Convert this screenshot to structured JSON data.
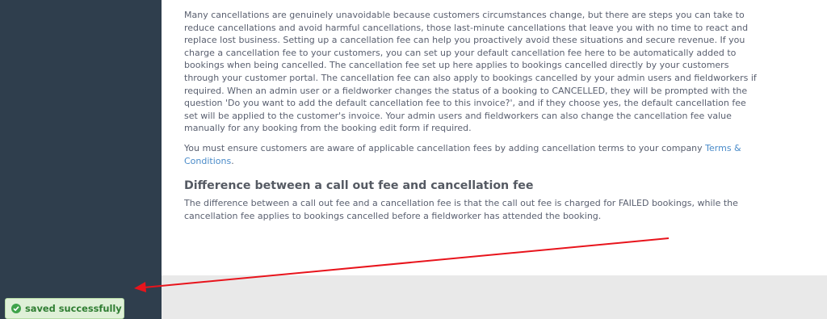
{
  "content": {
    "paragraph1": "Many cancellations are genuinely unavoidable because customers circumstances change, but there are steps you can take to reduce cancellations and avoid harmful cancellations, those last-minute cancellations that leave you with no time to react and replace lost business. Setting up a cancellation fee can help you proactively avoid these situations and secure revenue. If you charge a cancellation fee to your customers, you can set up your default cancellation fee here to be automatically added to bookings when being cancelled. The cancellation fee set up here applies to bookings cancelled directly by your customers through your customer portal. The cancellation fee can also apply to bookings cancelled by your admin users and fieldworkers if required. When an admin user or a fieldworker changes the status of a booking to CANCELLED, they will be prompted with the question 'Do you want to add the default cancellation fee to this invoice?', and if they choose yes, the default cancellation fee set will be applied to the customer's invoice. Your admin users and fieldworkers can also change the cancellation fee value manually for any booking from the booking edit form if required.",
    "paragraph2_text": "You must ensure customers are aware of applicable cancellation fees by adding cancellation terms to your company ",
    "paragraph2_link": "Terms & Conditions",
    "paragraph2_end": ".",
    "heading": "Difference between a call out fee and cancellation fee",
    "paragraph3": "The difference between a call out fee and a cancellation fee is that the call out fee is charged for FAILED bookings, while the cancellation fee applies to bookings cancelled before a fieldworker has attended the booking."
  },
  "toast": {
    "label": "saved successfully",
    "icon": "check-circle-icon"
  },
  "colors": {
    "sidebar": "#2f3e4d",
    "link": "#4a8bc9",
    "annotation_arrow": "#e8141c",
    "toast_bg": "#dff0d8",
    "toast_text": "#2f7d32"
  }
}
